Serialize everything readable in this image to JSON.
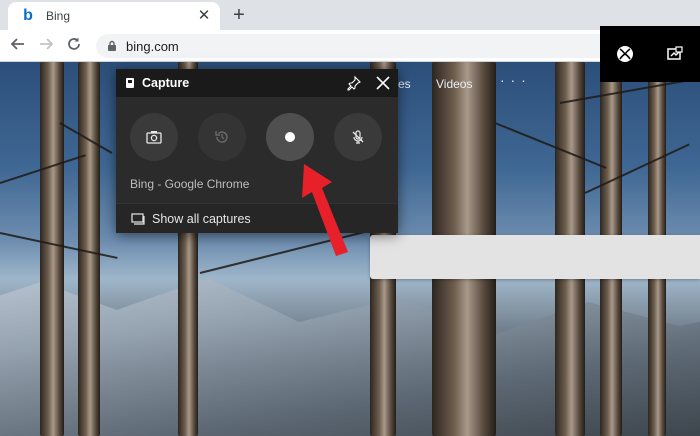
{
  "browser": {
    "tab_title": "Bing",
    "tab_favicon": "b",
    "new_tab_symbol": "+",
    "url": "bing.com"
  },
  "bing": {
    "nav_partial": "es",
    "nav_videos": "Videos",
    "nav_more": "· · ·"
  },
  "capture_widget": {
    "title": "Capture",
    "buttons": [
      {
        "name": "screenshot",
        "icon": "camera-icon"
      },
      {
        "name": "record-last-30-seconds",
        "icon": "replay-icon",
        "disabled": true
      },
      {
        "name": "start-recording",
        "icon": "record-dot-icon"
      },
      {
        "name": "microphone-toggle",
        "icon": "mic-off-icon"
      }
    ],
    "source_label": "Bing - Google Chrome",
    "footer_label": "Show all captures"
  },
  "colors": {
    "widget_bg": "#2b2b2b",
    "annotation_arrow": "#e8202a"
  }
}
